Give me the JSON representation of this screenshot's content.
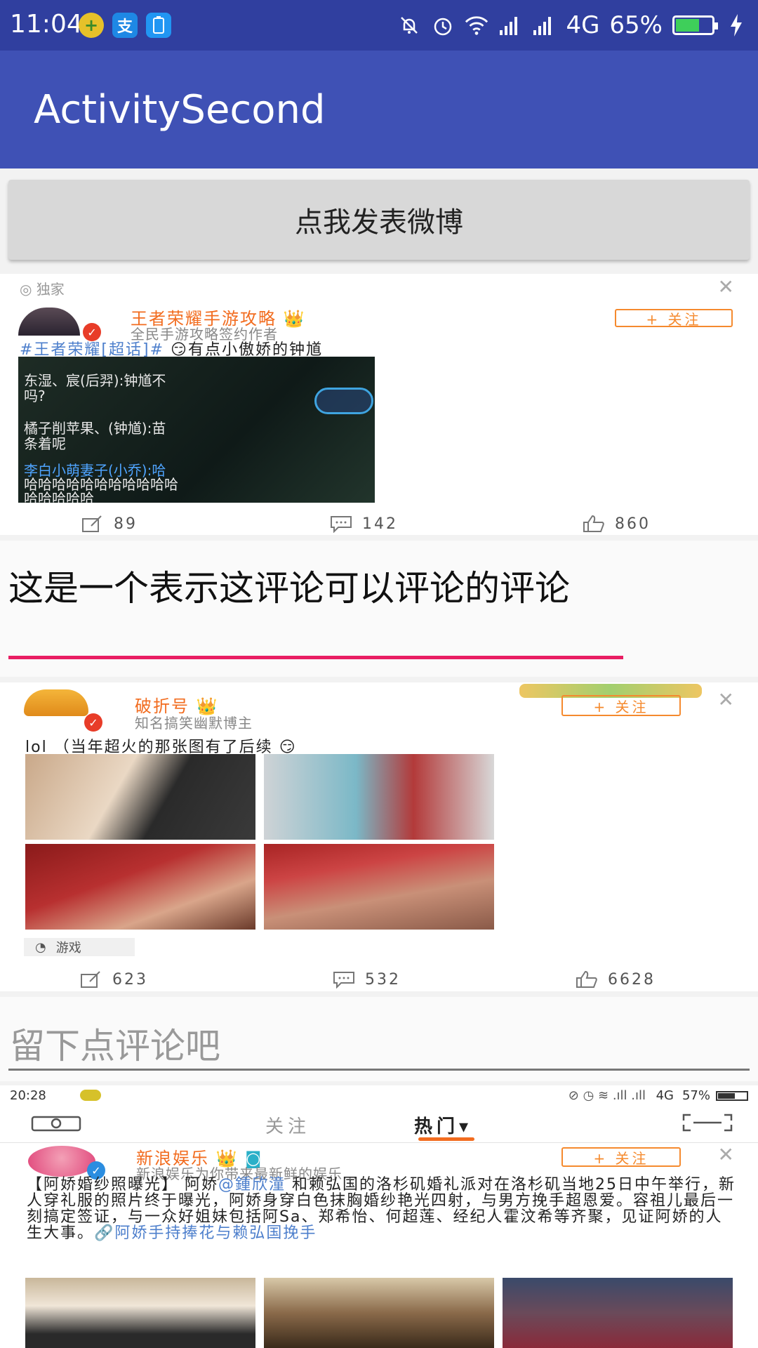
{
  "status_bar": {
    "time": "11:04",
    "network": "4G",
    "battery": "65%",
    "battery_level": 0.65
  },
  "app_bar": {
    "title": "ActivitySecond"
  },
  "post_button": {
    "label": "点我发表微博"
  },
  "card1": {
    "exclusive": "独家",
    "user_name": "王者荣耀手游攻略",
    "user_desc": "全民手游攻略签约作者",
    "follow": "+ 关注",
    "post_tag": "#王者荣耀[超话]#",
    "post_text": "有点小傲娇的钟馗",
    "game_lines": [
      "东湿、宸(后羿):钟馗不",
      "吗?",
      "橘子削苹果、(钟馗):苗",
      "条着呢",
      "李白小萌妻子(小乔):哈",
      "哈哈哈哈哈哈哈哈哈哈哈",
      "哈哈哈哈哈"
    ],
    "reposts": "89",
    "comments": "142",
    "likes": "860"
  },
  "comment_input_1": {
    "value": "这是一个表示这评论可以评论的评论"
  },
  "card2": {
    "user_name": "破折号",
    "user_desc": "知名搞笑幽默博主",
    "follow": "+ 关注",
    "post_text": "lol （当年超火的那张图有了后续",
    "channel": "游戏",
    "reposts": "623",
    "comments": "532",
    "likes": "6628"
  },
  "comment_input_2": {
    "placeholder": "留下点评论吧"
  },
  "card3": {
    "time": "20:28",
    "network": "4G",
    "battery": "57%",
    "tab_follow": "关注",
    "tab_hot": "热门",
    "user_name": "新浪娱乐",
    "user_desc": "新浪娱乐为你带来最新鲜的娱乐...",
    "follow": "+ 关注",
    "text_part1": "【阿娇婚纱照曝光】 阿娇",
    "mention": "@鍾欣潼",
    "text_part2": " 和赖弘国的洛杉矶婚礼派对在洛杉矶当地25日中午举行，新人穿礼服的照片终于曝光，阿娇身穿白色抹胸婚纱艳光四射，与男方挽手超恩爱。容祖儿最后一刻搞定签证，与一众好姐妹包括阿Sa、郑希怡、何超莲、经纪人霍汶希等齐聚，见证阿娇的人生大事。",
    "link_text": "🔗阿娇手持捧花与赖弘国挽手"
  },
  "colors": {
    "status_bar": "#303f9f",
    "app_bar": "#3f51b5",
    "accent_underline": "#e91e63",
    "weibo_orange": "#f26c1f"
  }
}
